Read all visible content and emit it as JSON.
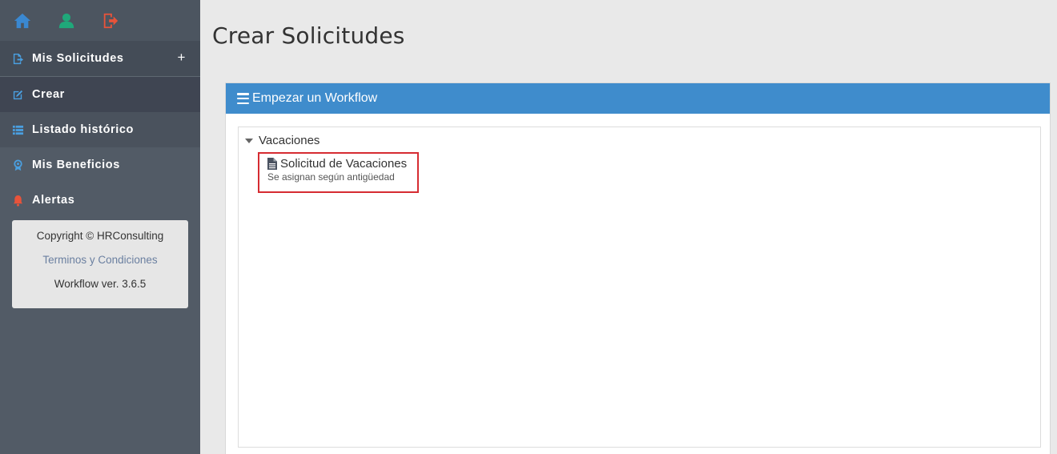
{
  "sidebar": {
    "top_icons": [
      "home-icon",
      "user-icon",
      "logout-icon"
    ],
    "items": [
      {
        "label": "Mis Solicitudes",
        "icon": "file-export-icon",
        "action": "+"
      },
      {
        "label": "Crear",
        "icon": "edit-icon"
      },
      {
        "label": "Listado histórico",
        "icon": "list-icon"
      },
      {
        "label": "Mis Beneficios",
        "icon": "award-icon"
      },
      {
        "label": "Alertas",
        "icon": "bell-icon"
      }
    ],
    "footer": {
      "copyright": "Copyright © HRConsulting",
      "terms": "Terminos y Condiciones",
      "version": "Workflow ver. 3.6.5"
    }
  },
  "main": {
    "title": "Crear Solicitudes",
    "panel": {
      "title": "Empezar un Workflow",
      "group": "Vacaciones",
      "item": {
        "title": "Solicitud de Vacaciones",
        "subtitle": "Se asignan según antigüedad"
      }
    }
  },
  "colors": {
    "sidebar_bg": "#525b66",
    "panel_header": "#3f8ccc",
    "highlight": "#d62c32",
    "home_icon": "#3a88d1",
    "user_icon": "#1fa87a",
    "logout_icon": "#e8533a"
  }
}
